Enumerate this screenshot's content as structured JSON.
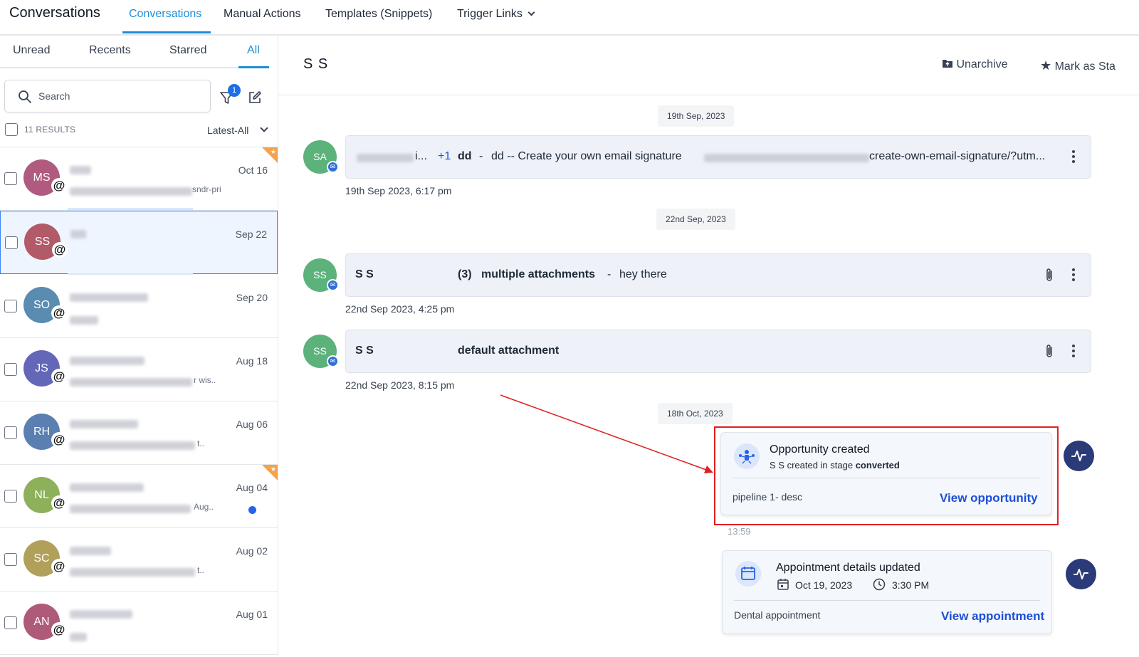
{
  "topnav": {
    "brand": "Conversations",
    "items": [
      {
        "label": "Conversations",
        "active": true
      },
      {
        "label": "Manual Actions"
      },
      {
        "label": "Templates (Snippets)"
      },
      {
        "label": "Trigger Links"
      }
    ]
  },
  "left": {
    "tabs": [
      {
        "label": "Unread"
      },
      {
        "label": "Recents"
      },
      {
        "label": "Starred"
      },
      {
        "label": "All",
        "active": true
      }
    ],
    "search_placeholder": "Search",
    "filter_count": "1",
    "results_label": "11 RESULTS",
    "sort_label": "Latest-All",
    "conversations": [
      {
        "initials": "MS",
        "color": "#b05a7f",
        "date": "Oct 16",
        "snippet_tail": "sndr-pri",
        "starred": true
      },
      {
        "initials": "SS",
        "color": "#b25a68",
        "date": "Sep 22",
        "selected": true
      },
      {
        "initials": "SO",
        "color": "#5a8bb0",
        "date": "Sep 20"
      },
      {
        "initials": "JS",
        "color": "#6466b8",
        "date": "Aug 18",
        "snippet_tail": "r wis.."
      },
      {
        "initials": "RH",
        "color": "#5a7fb0",
        "date": "Aug 06",
        "snippet_tail": "t.."
      },
      {
        "initials": "NL",
        "color": "#8db05a",
        "date": "Aug 04",
        "snippet_tail": "Aug..",
        "starred": true,
        "unread": true
      },
      {
        "initials": "SC",
        "color": "#b0a05a",
        "date": "Aug 02",
        "snippet_tail": "t.."
      },
      {
        "initials": "AN",
        "color": "#b05a7a",
        "date": "Aug 01"
      }
    ]
  },
  "main": {
    "contact_name": "S S",
    "actions": {
      "unarchive": "Unarchive",
      "mark_starred": "Mark as Sta"
    },
    "date_chips": [
      "19th Sep, 2023",
      "22nd Sep, 2023",
      "18th Oct, 2023"
    ],
    "messages": [
      {
        "avatar": "SA",
        "sender_suffix": "i...",
        "plus_count": "+1",
        "subject": "dd",
        "separator": "-",
        "body_pre": "dd -- Create your own email signature",
        "body_post": "create-own-email-signature/?utm...",
        "time": "19th Sep 2023, 6:17 pm"
      },
      {
        "avatar": "SS",
        "sender": "S S",
        "count": "(3)",
        "subject": "multiple attachments",
        "separator": "-",
        "body": "hey there",
        "time": "22nd Sep 2023, 4:25 pm"
      },
      {
        "avatar": "SS",
        "sender": "S S",
        "subject": "default attachment",
        "time": "22nd Sep 2023, 8:15 pm"
      }
    ],
    "opportunity": {
      "title": "Opportunity created",
      "desc_pre": "S S created in stage",
      "desc_stage": "converted",
      "pipeline": "pipeline 1- desc",
      "link": "View opportunity",
      "time": "13:59"
    },
    "appointment": {
      "title": "Appointment details updated",
      "date": "Oct 19, 2023",
      "time": "3:30 PM",
      "name": "Dental appointment",
      "link": "View appointment"
    }
  }
}
